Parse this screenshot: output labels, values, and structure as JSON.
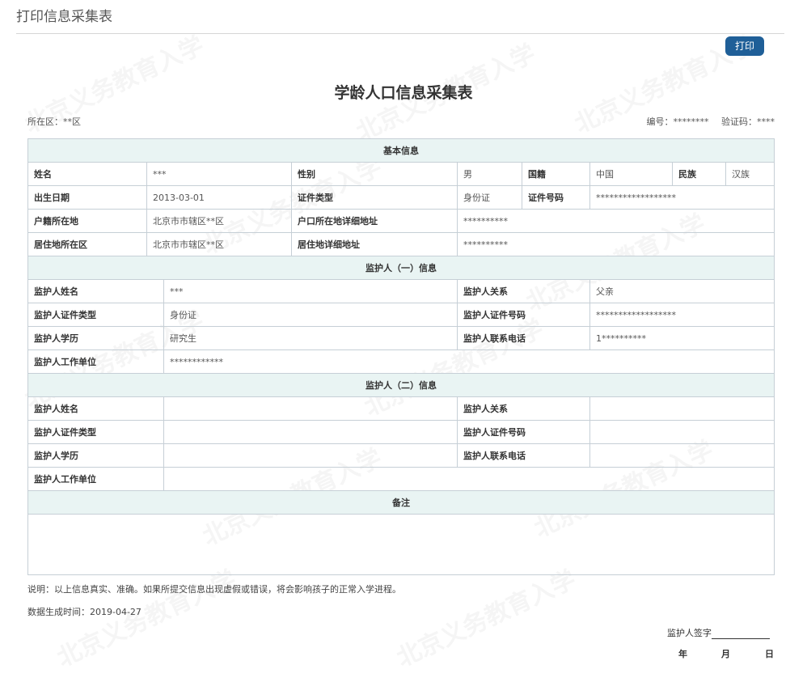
{
  "header": {
    "title": "打印信息采集表"
  },
  "toolbar": {
    "print_label": "打印"
  },
  "document": {
    "title": "学龄人口信息采集表",
    "district": "所在区：**区",
    "serial": "编号：********",
    "verify_code": "验证码：****"
  },
  "basic": {
    "section": "基本信息",
    "name_label": "姓名",
    "name": "***",
    "gender_label": "性别",
    "gender": "男",
    "nationality_label": "国籍",
    "nationality": "中国",
    "ethnicity_label": "民族",
    "ethnicity": "汉族",
    "birth_label": "出生日期",
    "birth": "2013-03-01",
    "id_type_label": "证件类型",
    "id_type": "身份证",
    "id_no_label": "证件号码",
    "id_no": "******************",
    "hukou_district_label": "户籍所在地",
    "hukou_district": "北京市市辖区**区",
    "hukou_address_label": "户口所在地详细地址",
    "hukou_address": "**********",
    "residence_district_label": "居住地所在区",
    "residence_district": "北京市市辖区**区",
    "residence_address_label": "居住地详细地址",
    "residence_address": "**********"
  },
  "guardian1": {
    "section": "监护人（一）信息",
    "name_label": "监护人姓名",
    "name": "***",
    "relation_label": "监护人关系",
    "relation": "父亲",
    "id_type_label": "监护人证件类型",
    "id_type": "身份证",
    "id_no_label": "监护人证件号码",
    "id_no": "******************",
    "education_label": "监护人学历",
    "education": "研究生",
    "phone_label": "监护人联系电话",
    "phone": "1**********",
    "employer_label": "监护人工作单位",
    "employer": "************"
  },
  "guardian2": {
    "section": "监护人（二）信息",
    "name_label": "监护人姓名",
    "name": "",
    "relation_label": "监护人关系",
    "relation": "",
    "id_type_label": "监护人证件类型",
    "id_type": "",
    "id_no_label": "监护人证件号码",
    "id_no": "",
    "education_label": "监护人学历",
    "education": "",
    "phone_label": "监护人联系电话",
    "phone": "",
    "employer_label": "监护人工作单位",
    "employer": ""
  },
  "remarks": {
    "section": "备注",
    "content": ""
  },
  "footer": {
    "note": "说明：以上信息真实、准确。如果所提交信息出现虚假或错误，将会影响孩子的正常入学进程。",
    "generated": "数据生成时间：2019-04-27",
    "signature_label": "监护人签字",
    "year": "年",
    "month": "月",
    "day": "日"
  },
  "watermark": {
    "text": "北京义务教育入学"
  }
}
